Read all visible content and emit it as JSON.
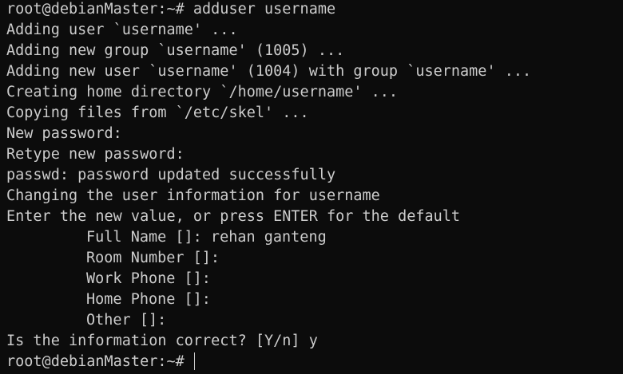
{
  "terminal": {
    "lines": [
      "root@debianMaster:~# adduser username",
      "Adding user `username' ...",
      "Adding new group `username' (1005) ...",
      "Adding new user `username' (1004) with group `username' ...",
      "Creating home directory `/home/username' ...",
      "Copying files from `/etc/skel' ...",
      "New password:",
      "Retype new password:",
      "passwd: password updated successfully",
      "Changing the user information for username",
      "Enter the new value, or press ENTER for the default",
      "Full Name []: rehan ganteng",
      "Room Number []:",
      "Work Phone []:",
      "Home Phone []:",
      "Other []:",
      "Is the information correct? [Y/n] y"
    ],
    "prompt": "root@debianMaster:~# "
  }
}
